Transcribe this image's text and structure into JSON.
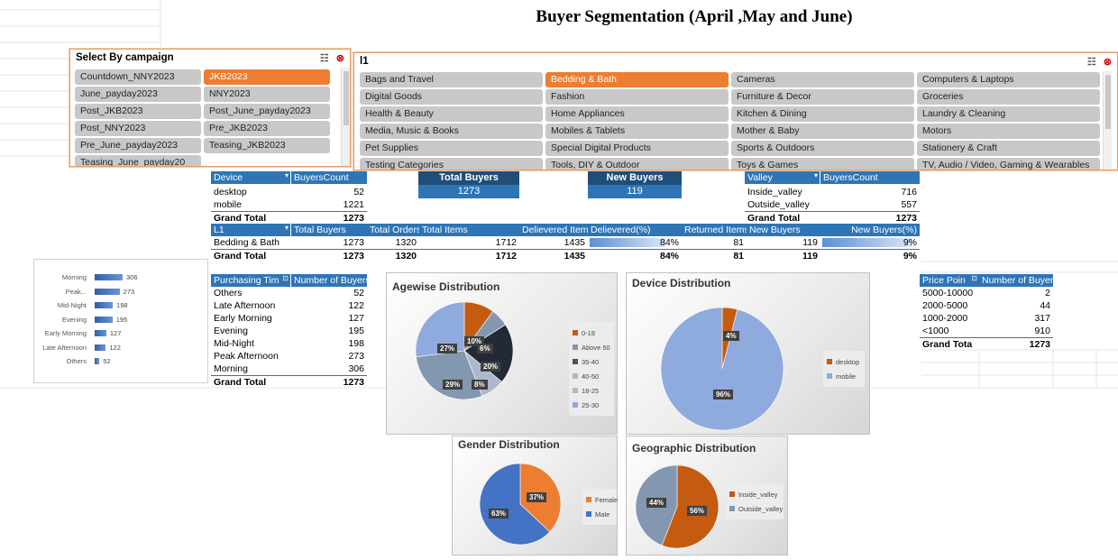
{
  "title": "Buyer Segmentation (April ,May and June)",
  "colors": {
    "accent": "#ed7d31",
    "header_blue": "#2e75b6",
    "dark_blue": "#1f4e79",
    "pie_light_blue": "#8faadc"
  },
  "campaign_slicer": {
    "title": "Select By campaign",
    "items": [
      "Countdown_NNY2023",
      "JKB2023",
      "June_payday2023",
      "NNY2023",
      "Post_JKB2023",
      "Post_June_payday2023",
      "Post_NNY2023",
      "Pre_JKB2023",
      "Pre_June_payday2023",
      "Teasing_JKB2023",
      "Teasing_June_payday20"
    ],
    "selected": "JKB2023"
  },
  "l1_slicer": {
    "title": "l1",
    "items": [
      "Bags and Travel",
      "Bedding & Bath",
      "Cameras",
      "Computers & Laptops",
      "Digital Goods",
      "Fashion",
      "Furniture & Decor",
      "Groceries",
      "Health & Beauty",
      "Home Appliances",
      "Kitchen & Dining",
      "Laundry & Cleaning",
      "Media, Music & Books",
      "Mobiles & Tablets",
      "Mother & Baby",
      "Motors",
      "Pet Supplies",
      "Special Digital Products",
      "Sports & Outdoors",
      "Stationery & Craft",
      "Testing Categories",
      "Tools, DIY & Outdoor",
      "Toys & Games",
      "TV, Audio / Video, Gaming & Wearables"
    ],
    "selected": "Bedding & Bath"
  },
  "device_table": {
    "headers": [
      "Device",
      "BuyersCount"
    ],
    "rows": [
      [
        "desktop",
        "52"
      ],
      [
        "mobile",
        "1221"
      ]
    ],
    "total": [
      "Grand Total",
      "1273"
    ]
  },
  "kpis": {
    "total_buyers_label": "Total Buyers",
    "total_buyers_value": "1273",
    "new_buyers_label": "New Buyers",
    "new_buyers_value": "119"
  },
  "valley_table": {
    "headers": [
      "Valley",
      "BuyersCount"
    ],
    "rows": [
      [
        "Inside_valley",
        "716"
      ],
      [
        "Outside_valley",
        "557"
      ]
    ],
    "total": [
      "Grand Total",
      "1273"
    ]
  },
  "l1_table": {
    "headers": [
      "L1",
      "Total Buyers",
      "Total Orders",
      "Total Items",
      "Delievered Items",
      "Delievered(%)",
      "Returned Items",
      "New Buyers",
      "New Buyers(%)"
    ],
    "row": [
      "Bedding & Bath",
      "1273",
      "1320",
      "1712",
      "1435",
      "84%",
      "81",
      "119",
      "9%"
    ],
    "total": [
      "Grand Total",
      "1273",
      "1320",
      "1712",
      "1435",
      "84%",
      "81",
      "119",
      "9%"
    ],
    "delivered_fraction": 0.84,
    "new_buyers_fraction": 0.09
  },
  "purchase_table": {
    "headers": [
      "Purchasing Tim",
      "Number of Buyers"
    ],
    "rows": [
      [
        "Others",
        "52"
      ],
      [
        "Late Afternoon",
        "122"
      ],
      [
        "Early Morning",
        "127"
      ],
      [
        "Evening",
        "195"
      ],
      [
        "Mid-Night",
        "198"
      ],
      [
        "Peak Afternoon",
        "273"
      ],
      [
        "Morning",
        "306"
      ]
    ],
    "total": [
      "Grand Total",
      "1273"
    ]
  },
  "price_table": {
    "headers": [
      "Price Poin",
      "Number of Buyers"
    ],
    "rows": [
      [
        "5000-10000",
        "2"
      ],
      [
        "2000-5000",
        "44"
      ],
      [
        "1000-2000",
        "317"
      ],
      [
        "<1000",
        "910"
      ]
    ],
    "total": [
      "Grand Tota",
      "1273"
    ]
  },
  "chart_data": [
    {
      "type": "bar",
      "orientation": "horizontal",
      "categories": [
        "Morning",
        "Peak...",
        "Mid-Night",
        "Evening",
        "Early Morning",
        "Late Afternoon",
        "Others"
      ],
      "values": [
        306,
        273,
        198,
        195,
        127,
        122,
        52
      ],
      "title": "",
      "color": "#2f5fa8"
    },
    {
      "type": "pie",
      "title": "Agewise Distribution",
      "labels": [
        "0-18",
        "Above 50",
        "35-40",
        "40-50",
        "18-25",
        "25-30"
      ],
      "values": [
        10,
        6,
        20,
        8,
        29,
        27
      ],
      "colors": [
        "#c55a11",
        "#8497b0",
        "#222a35",
        "#adb9ca",
        "#8497b0",
        "#8faadc"
      ],
      "legend_colors": [
        "#c55a11",
        "#8497b0",
        "#44546a",
        "#adb9ca",
        "#acb9ca",
        "#8faadc"
      ],
      "display_labels": [
        "10%",
        "6%",
        "20%",
        "8%",
        "29%",
        "27%"
      ]
    },
    {
      "type": "pie",
      "title": "Device Distribution",
      "labels": [
        "desktop",
        "mobile"
      ],
      "values": [
        4,
        96
      ],
      "colors": [
        "#c55a11",
        "#8faadc"
      ],
      "display_labels": [
        "4%",
        "96%"
      ]
    },
    {
      "type": "pie",
      "title": "Gender Distribution",
      "labels": [
        "Female",
        "Male"
      ],
      "values": [
        37,
        63
      ],
      "colors": [
        "#ed7d31",
        "#4472c4"
      ],
      "display_labels": [
        "37%",
        "63%"
      ]
    },
    {
      "type": "pie",
      "title": "Geographic Distribution",
      "labels": [
        "Inside_valley",
        "Outside_valley"
      ],
      "values": [
        56,
        44
      ],
      "colors": [
        "#c55a11",
        "#8497b0"
      ],
      "display_labels": [
        "56%",
        "44%"
      ]
    }
  ]
}
